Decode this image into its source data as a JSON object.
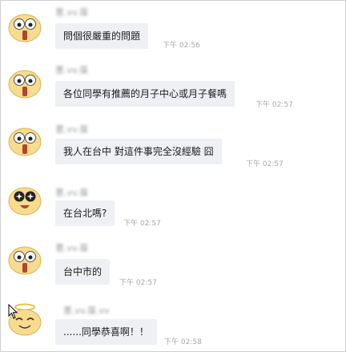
{
  "messages": [
    {
      "sender": "蔥.vv.葆",
      "text": "問個很嚴重的問題",
      "time": "下午 02:56",
      "avatar": "surprised-face-icon"
    },
    {
      "sender": "蔥.vv.葆",
      "text": "各位同學有推薦的月子中心或月子餐嗎",
      "time": "下午 02:57",
      "avatar": "surprised-face-icon"
    },
    {
      "sender": "蔥.vv.葆",
      "text": "我人在台中  對這件事完全沒經驗  囧",
      "time": "下午 02:57",
      "avatar": "surprised-face-icon"
    },
    {
      "sender": "蔥.vv.葆",
      "text": "在台北嗎?",
      "time": "下午 02:57",
      "avatar": "starry-eyes-face-icon"
    },
    {
      "sender": "蔥.vv.葆",
      "text": "台中市的",
      "time": "下午 02:57",
      "avatar": "surprised-face-icon"
    },
    {
      "sender": "蔥.vv.葆.vv",
      "text": "......同學恭喜啊！！",
      "time": "下午 02:58",
      "avatar": "angel-face-icon"
    }
  ],
  "colors": {
    "bubble": "#eef0f4",
    "time": "#a8a8a8",
    "face": "#f7dc8e"
  }
}
